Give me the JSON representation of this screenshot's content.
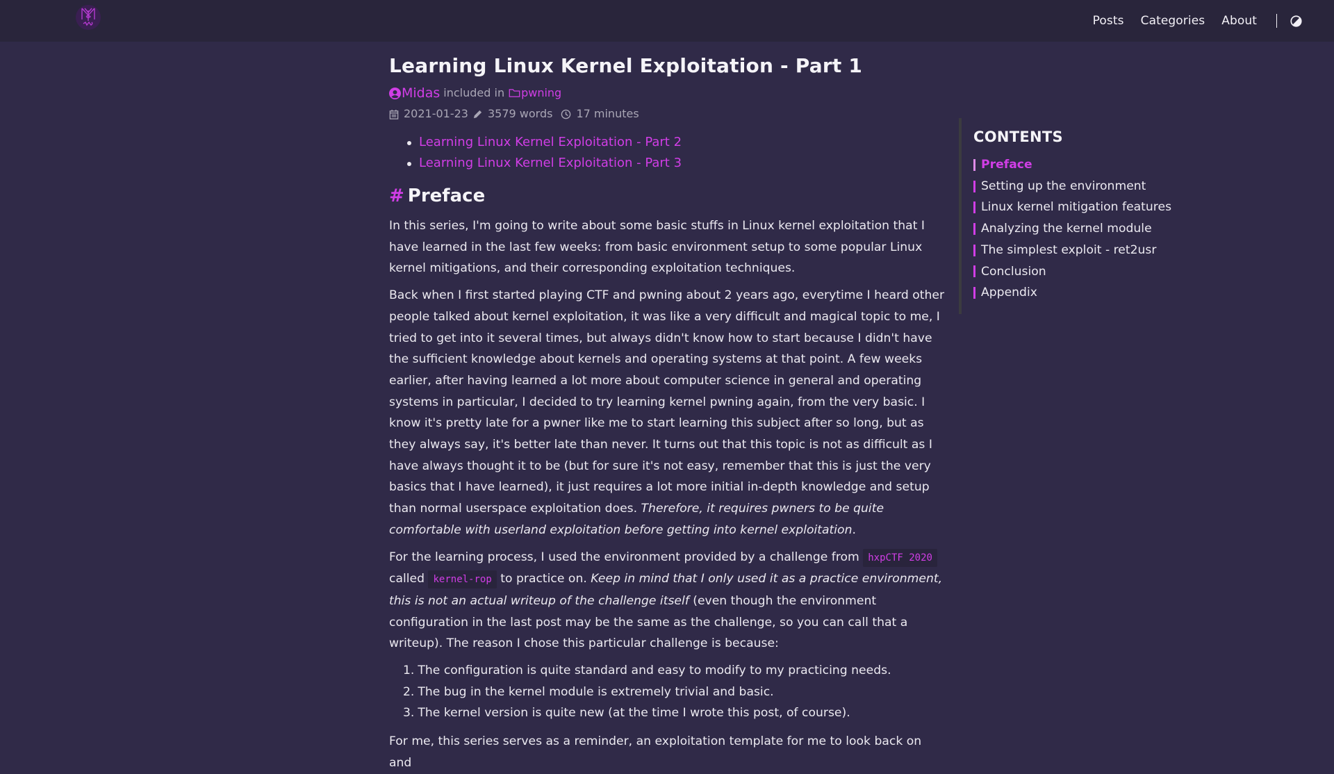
{
  "header": {
    "logo_alt": "site logo",
    "nav": [
      {
        "label": "Posts"
      },
      {
        "label": "Categories"
      },
      {
        "label": "About"
      }
    ],
    "theme_toggle_icon": "contrast-icon"
  },
  "post": {
    "title": "Learning Linux Kernel Exploitation - Part 1",
    "author": "Midas",
    "included_in_label": "included in",
    "category": "pwning",
    "date": "2021-01-23",
    "word_count": "3579 words",
    "reading_time": "17 minutes",
    "series": [
      {
        "label": "Learning Linux Kernel Exploitation - Part 2"
      },
      {
        "label": "Learning Linux Kernel Exploitation - Part 3"
      }
    ],
    "section_heading": "Preface",
    "section_hash": "#",
    "p1": "In this series, I'm going to write about some basic stuffs in Linux kernel exploitation that I have learned in the last few weeks: from basic environment setup to some popular Linux kernel mitigations, and their corresponding exploitation techniques.",
    "p2_text": "Back when I first started playing CTF and pwning about 2 years ago, everytime I heard other people talked about kernel exploitation, it was like a very difficult and magical topic to me, I tried to get into it several times, but always didn't know how to start because I didn't have the sufficient knowledge about kernels and operating systems at that point. A few weeks earlier, after having learned a lot more about computer science in general and operating systems in particular, I decided to try learning kernel pwning again, from the very basic. I know it's pretty late for a pwner like me to start learning this subject after so long, but as they always say, it's better late than never. It turns out that this topic is not as difficult as I have always thought it to be (but for sure it's not easy, remember that this is just the very basics that I have learned), it just requires a lot more initial in-depth knowledge and setup than normal userspace exploitation does. ",
    "p2_em": "Therefore, it requires pwners to be quite comfortable with userland exploitation before getting into kernel exploitation",
    "p2_end": ".",
    "p3_a": "For the learning process, I used the environment provided by a challenge from ",
    "p3_code1": "hxpCTF 2020",
    "p3_b": " called ",
    "p3_code2": "kernel-rop",
    "p3_c": " to practice on. ",
    "p3_em": "Keep in mind that I only used it as a practice environment, this is not an actual writeup of the challenge itself",
    "p3_d": " (even though the environment configuration in the last post may be the same as the challenge, so you can call that a writeup). The reason I chose this particular challenge is because:",
    "reasons": [
      {
        "num": "1.",
        "text": "The configuration is quite standard and easy to modify to my practicing needs."
      },
      {
        "num": "2.",
        "text": "The bug in the kernel module is extremely trivial and basic."
      },
      {
        "num": "3.",
        "text": "The kernel version is quite new (at the time I wrote this post, of course)."
      }
    ],
    "p4": "For me, this series serves as a reminder, an exploitation template for me to look back on and"
  },
  "toc": {
    "title": "CONTENTS",
    "items": [
      {
        "label": "Preface",
        "active": true
      },
      {
        "label": "Setting up the environment"
      },
      {
        "label": "Linux kernel mitigation features"
      },
      {
        "label": "Analyzing the kernel module"
      },
      {
        "label": "The simplest exploit - ret2usr"
      },
      {
        "label": "Conclusion"
      },
      {
        "label": "Appendix"
      }
    ]
  },
  "colors": {
    "accent": "#d13ee6",
    "background": "#302a48",
    "header_bg": "#29253b",
    "text": "#ebe9f0",
    "muted": "#a9a6b5"
  }
}
